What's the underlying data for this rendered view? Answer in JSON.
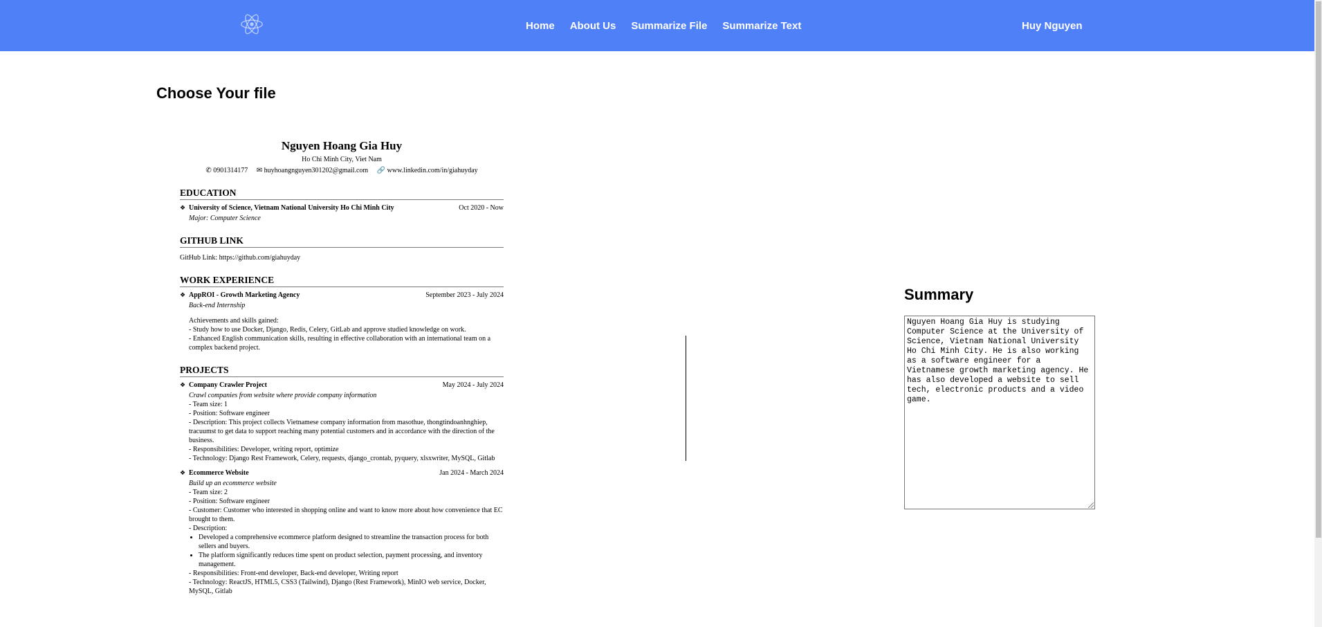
{
  "nav": {
    "links": [
      "Home",
      "About Us",
      "Summarize File",
      "Summarize Text"
    ],
    "user": "Huy Nguyen",
    "logo_icon": "react-atom-icon"
  },
  "page": {
    "title": "Choose Your file"
  },
  "resume": {
    "name": "Nguyen Hoang Gia Huy",
    "location": "Ho Chi Minh City, Viet Nam",
    "phone": "0901314177",
    "email": "huyhoangnguyen301202@gmail.com",
    "linkedin": "www.linkedin.com/in/giahuyday",
    "education_heading": "EDUCATION",
    "education": {
      "school": "University of Science, Vietnam National University Ho Chi Minh City",
      "date": "Oct 2020 - Now",
      "major": "Major: Computer Science"
    },
    "github_heading": "GITHUB LINK",
    "github": "GitHub Link: https://github.com/giahuyday",
    "work_heading": "WORK EXPERIENCE",
    "work": {
      "company": "AppROI - Growth Marketing Agency",
      "date": "September 2023 - July 2024",
      "role": "Back-end Internship",
      "lines": [
        "Achievements and skills gained:",
        "- Study how to use Docker, Django, Redis, Celery, GitLab and approve studied knowledge on work.",
        "- Enhanced English communication skills, resulting in effective collaboration with an international team on a complex backend project."
      ]
    },
    "projects_heading": "PROJECTS",
    "project1": {
      "name": "Company Crawler Project",
      "date": "May 2024 - July 2024",
      "desc": "Crawl companies from website where provide company information",
      "lines": [
        "- Team size: 1",
        "- Position: Software engineer",
        "- Description: This project collects Vietnamese company information from masothue, thongtindoanhnghiep, tracuumst to get data to support reaching many potential customers and in accordance with the direction of the business.",
        "- Responsibilities: Developer, writing report, optimize",
        "- Technology: Django Rest Framework, Celery, requests, django_crontab, pyquery, xlsxwriter, MySQL, Gitlab"
      ]
    },
    "project2": {
      "name": "Ecommerce Website",
      "date": "Jan 2024 - March 2024",
      "desc": "Build up an ecommerce website",
      "lines_before": [
        "- Team size: 2",
        "- Position: Software engineer",
        "- Customer: Customer who interested in shopping online and want to know more about how convenience that EC brought to them.",
        "- Description:"
      ],
      "bullets": [
        "Developed a comprehensive ecommerce platform designed to streamline the transaction process for both sellers and buyers.",
        "The platform significantly reduces time spent on product selection, payment processing, and inventory management."
      ],
      "lines_after": [
        "- Responsibilities: Front-end developer, Back-end developer, Writing report",
        "- Technology: ReactJS, HTML5, CSS3 (Tailwind), Django (Rest Framework), MinIO web service, Docker, MySQL, Gitlab"
      ]
    }
  },
  "summary": {
    "heading": "Summary",
    "text": "Nguyen Hoang Gia Huy is studying Computer Science at the University of Science, Vietnam National University Ho Chi Minh City. He is also working as a software engineer for a Vietnamese growth marketing agency. He has also developed a website to sell tech, electronic products and a video game."
  }
}
